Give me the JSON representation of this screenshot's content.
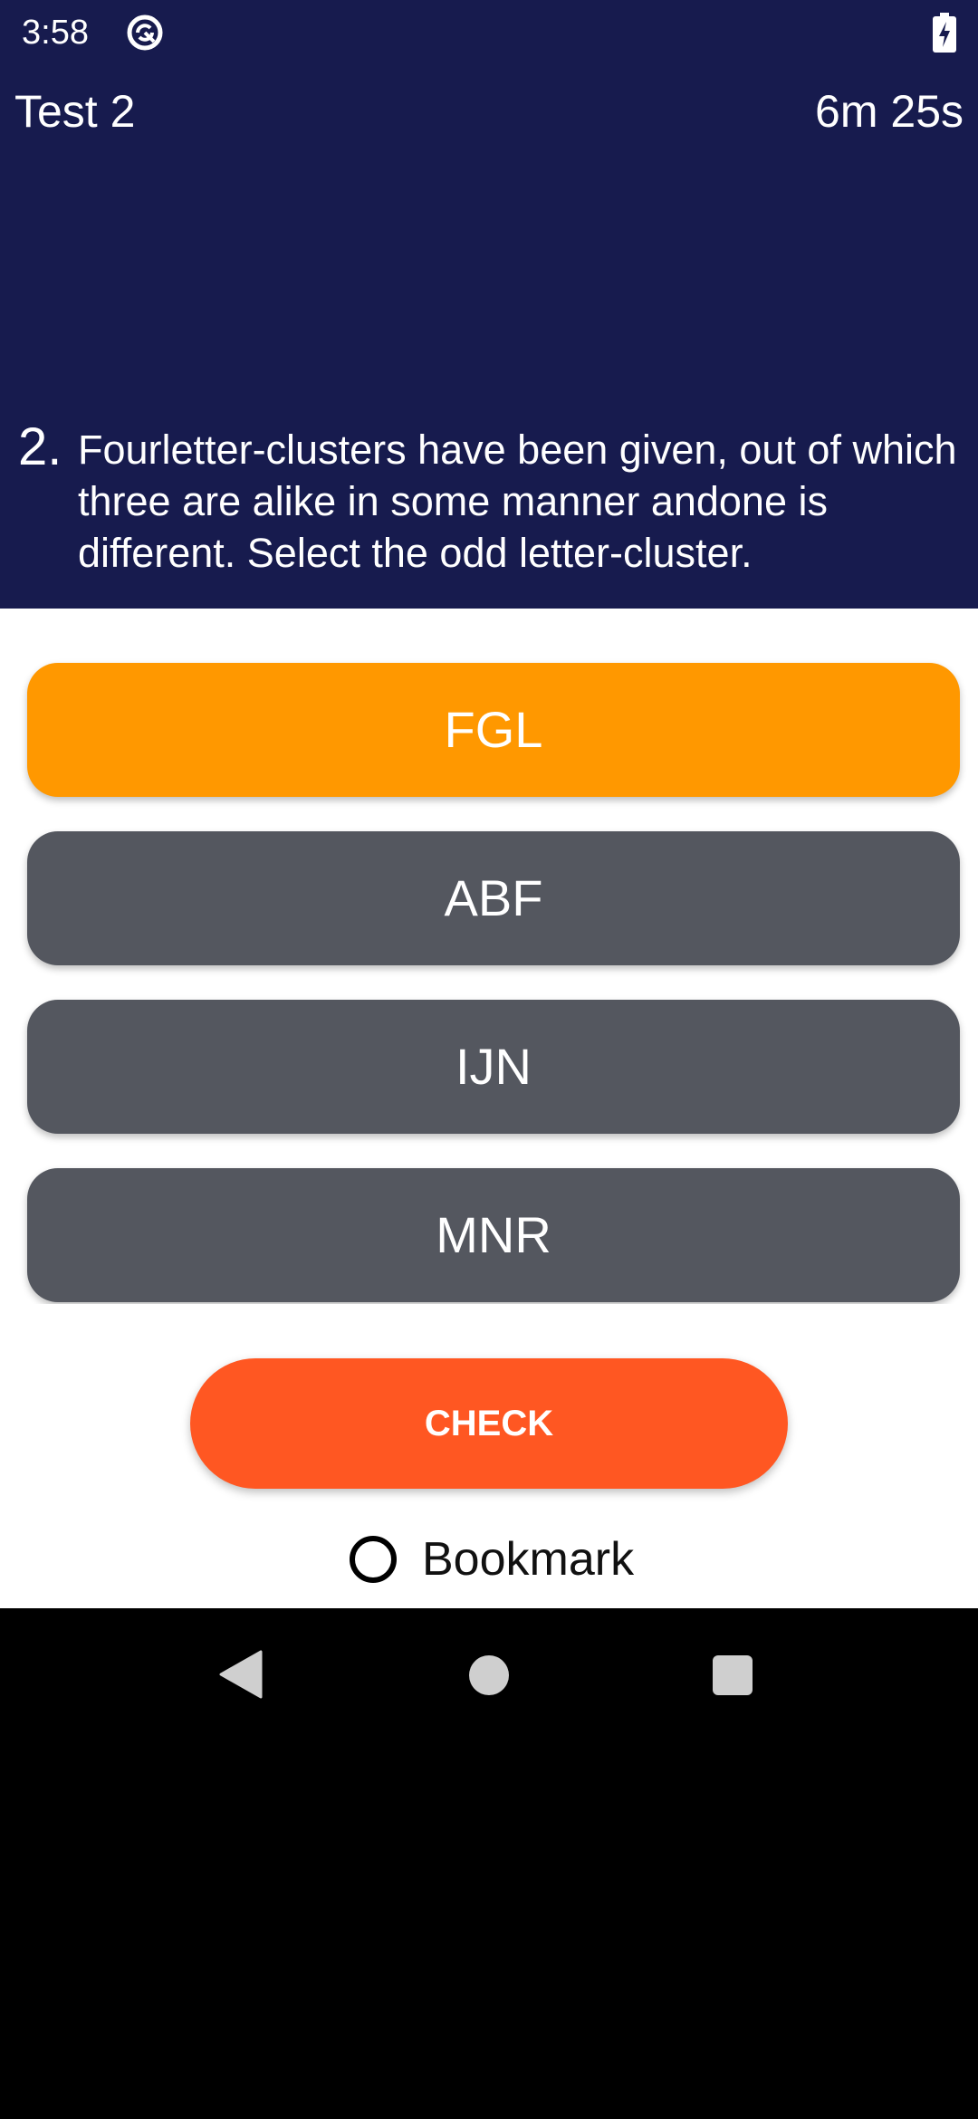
{
  "status_bar": {
    "time": "3:58",
    "app_icon": "sync-app-icon",
    "battery_icon": "battery-charging-icon"
  },
  "app_bar": {
    "title": "Test 2",
    "timer": "6m 25s"
  },
  "question": {
    "number": "2.",
    "text": "Fourletter-clusters have been given, out of which three are alike in some manner andone is different. Select the odd letter-cluster."
  },
  "options": [
    {
      "label": "FGL",
      "selected": true
    },
    {
      "label": "ABF",
      "selected": false
    },
    {
      "label": "IJN",
      "selected": false
    },
    {
      "label": "MNR",
      "selected": false
    }
  ],
  "check_button": {
    "label": "CHECK"
  },
  "bookmark": {
    "label": "Bookmark",
    "checked": false
  },
  "nav_bar": {
    "back_icon": "back-triangle-icon",
    "home_icon": "home-circle-icon",
    "recents_icon": "recents-square-icon"
  },
  "colors": {
    "header_bg": "#171b4e",
    "selected_option": "#ff9800",
    "option_bg": "#54575f",
    "check_button": "#ff5722"
  }
}
